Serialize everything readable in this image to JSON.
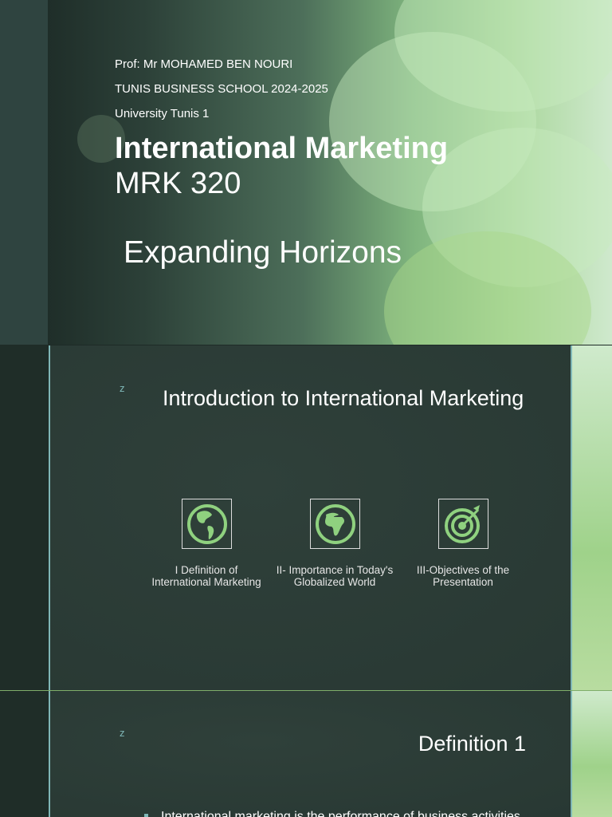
{
  "title_slide": {
    "professor": "Prof: Mr MOHAMED   BEN NOURI",
    "school": "TUNIS BUSINESS SCHOOL 2024-2025",
    "university": "University Tunis 1",
    "title": "International Marketing",
    "course_code": "MRK 320",
    "subtitle": "Expanding Horizons"
  },
  "intro_slide": {
    "marker": "z",
    "title": "Introduction to International Marketing",
    "items": [
      {
        "icon": "globe-americas-icon",
        "label": "I Definition of International Marketing"
      },
      {
        "icon": "globe-africa-icon",
        "label": "II- Importance in Today's Globalized World"
      },
      {
        "icon": "target-icon",
        "label": "III-Objectives of the Presentation"
      }
    ]
  },
  "definition_slide": {
    "marker": "z",
    "title": "Definition 1",
    "bullet": "International marketing is the performance of business activities"
  },
  "colors": {
    "accent": "#7fb7b7",
    "icon_green": "#8fd17f"
  }
}
